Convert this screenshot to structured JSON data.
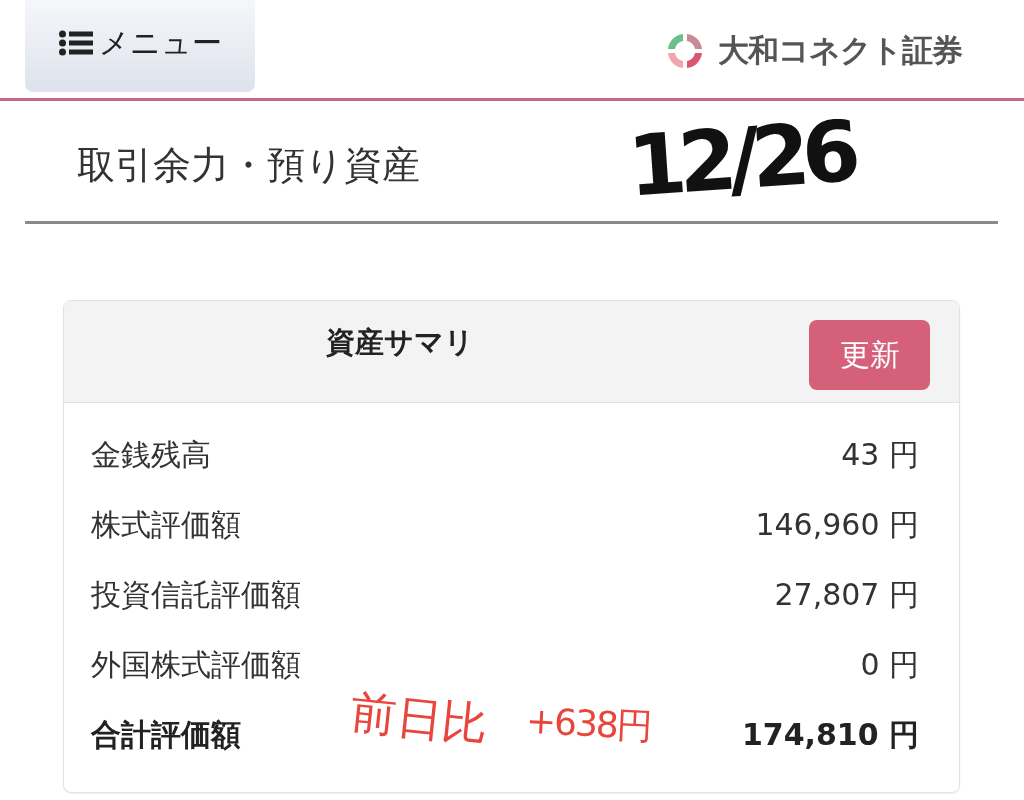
{
  "header": {
    "menu_button": {
      "label": "メニュー"
    },
    "logo": {
      "text": "大和コネクト証券"
    }
  },
  "page_title": "取引余力・預り資産",
  "summary_card": {
    "title": "資産サマリ",
    "refresh_button": "更新",
    "rows": [
      {
        "label": "金銭残高",
        "value": "43 円",
        "kind": "normal"
      },
      {
        "label": "株式評価額",
        "value": "146,960 円",
        "kind": "normal"
      },
      {
        "label": "投資信託評価額",
        "value": "27,807 円",
        "kind": "normal"
      },
      {
        "label": "外国株式評価額",
        "value": "0 円",
        "kind": "normal"
      },
      {
        "label": "合計評価額",
        "value": "174,810 円",
        "kind": "total"
      }
    ]
  },
  "annotations": [
    {
      "text": "12/26",
      "color": "#111111"
    },
    {
      "text": "前日比",
      "color": "#e8453c"
    },
    {
      "text": "+638円",
      "color": "#e8453c"
    }
  ]
}
